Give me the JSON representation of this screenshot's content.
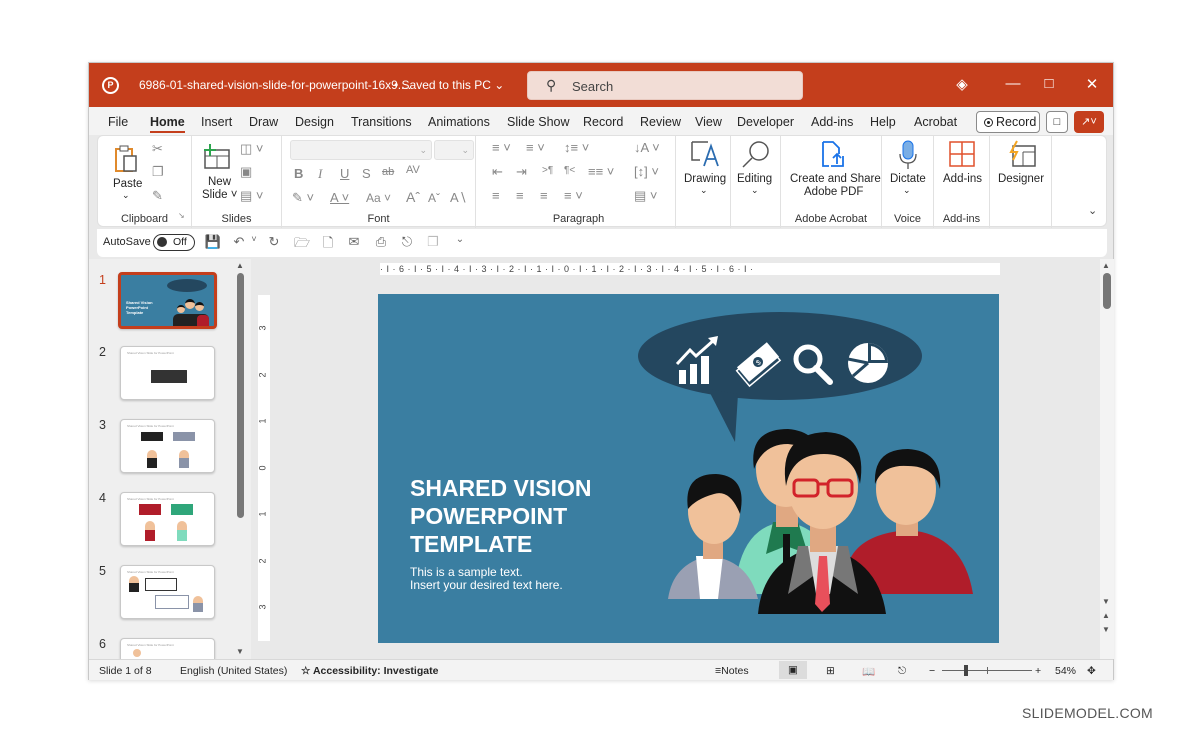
{
  "titlebar": {
    "doc_title": "6986-01-shared-vision-slide-for-powerpoint-16x9....",
    "save_status": "• Saved to this PC",
    "search_placeholder": "Search",
    "icons": [
      "powerpoint-logo-icon",
      "search-icon",
      "premium-diamond-icon",
      "minimize-icon",
      "maximize-icon",
      "close-icon"
    ]
  },
  "menu": {
    "tabs": [
      "File",
      "Home",
      "Insert",
      "Draw",
      "Design",
      "Transitions",
      "Animations",
      "Slide Show",
      "Record",
      "Review",
      "View",
      "Developer",
      "Add-ins",
      "Help",
      "Acrobat"
    ],
    "active_tab": "Home",
    "record_label": "Record"
  },
  "ribbon": {
    "clipboard": {
      "paste": "Paste",
      "label": "Clipboard"
    },
    "slides": {
      "new_slide_1": "New",
      "new_slide_2": "Slide",
      "label": "Slides"
    },
    "font": {
      "bold": "B",
      "italic": "I",
      "underline": "U",
      "strike": "S",
      "strike2": "ab",
      "spacing": "AV",
      "case": "Aa",
      "grow": "Aˆ",
      "shrink": "Aˇ",
      "label": "Font",
      "font_name": "",
      "font_size": ""
    },
    "paragraph": {
      "label": "Paragraph"
    },
    "drawing": {
      "label": "Drawing"
    },
    "editing": {
      "label": "Editing"
    },
    "acrobat": {
      "button_1": "Create and Share",
      "button_2": "Adobe PDF",
      "label": "Adobe Acrobat"
    },
    "voice": {
      "dictate": "Dictate",
      "label": "Voice"
    },
    "addins": {
      "button": "Add-ins",
      "label": "Add-ins"
    },
    "designer": {
      "button": "Designer"
    }
  },
  "qat": {
    "autosave_label": "AutoSave",
    "autosave_state": "Off"
  },
  "thumbnails": [
    {
      "num": "1",
      "active": true,
      "caption": "Shared Vision PowerPoint Template"
    },
    {
      "num": "2",
      "active": false,
      "caption": "Shared Vision Slide for PowerPoint"
    },
    {
      "num": "3",
      "active": false,
      "caption": "Shared Vision Slide for PowerPoint"
    },
    {
      "num": "4",
      "active": false,
      "caption": "Shared Vision Slide for PowerPoint"
    },
    {
      "num": "5",
      "active": false,
      "caption": "Shared Vision Slide for PowerPoint"
    },
    {
      "num": "6",
      "active": false,
      "caption": "Shared Vision Slide for PowerPoint"
    }
  ],
  "ruler": {
    "horizontal": "· I · 6 · I · 5 · I · 4 · I · 3 · I · 2 · I · 1 · I · 0 · I · 1 · I · 2 · I · 3 · I · 4 · I · 5 · I · 6 · I ·",
    "vertical": [
      "3",
      "2",
      "1",
      "0",
      "1",
      "2",
      "3"
    ]
  },
  "slide": {
    "title_1": "SHARED VISION",
    "title_2": "POWERPOINT",
    "title_3": "TEMPLATE",
    "sub_1": "This is a sample text.",
    "sub_2": "Insert your desired text here.",
    "bubble_icons": [
      "growth-chart-icon",
      "money-icon",
      "magnifier-icon",
      "pie-chart-icon"
    ],
    "colors": {
      "background": "#3a7ea1",
      "bubble": "#24475f",
      "skin": "#f0c19a",
      "glasses": "#d2232a",
      "tie": "#e8505b",
      "red_shirt": "#b01d2a",
      "green_shirt": "#7fdbbd"
    }
  },
  "status": {
    "slide_info": "Slide 1 of 8",
    "language": "English (United States)",
    "accessibility": "Accessibility: Investigate",
    "notes": "Notes",
    "zoom": "54%",
    "zoom_level_percent": 54
  },
  "watermark": "SLIDEMODEL.COM"
}
